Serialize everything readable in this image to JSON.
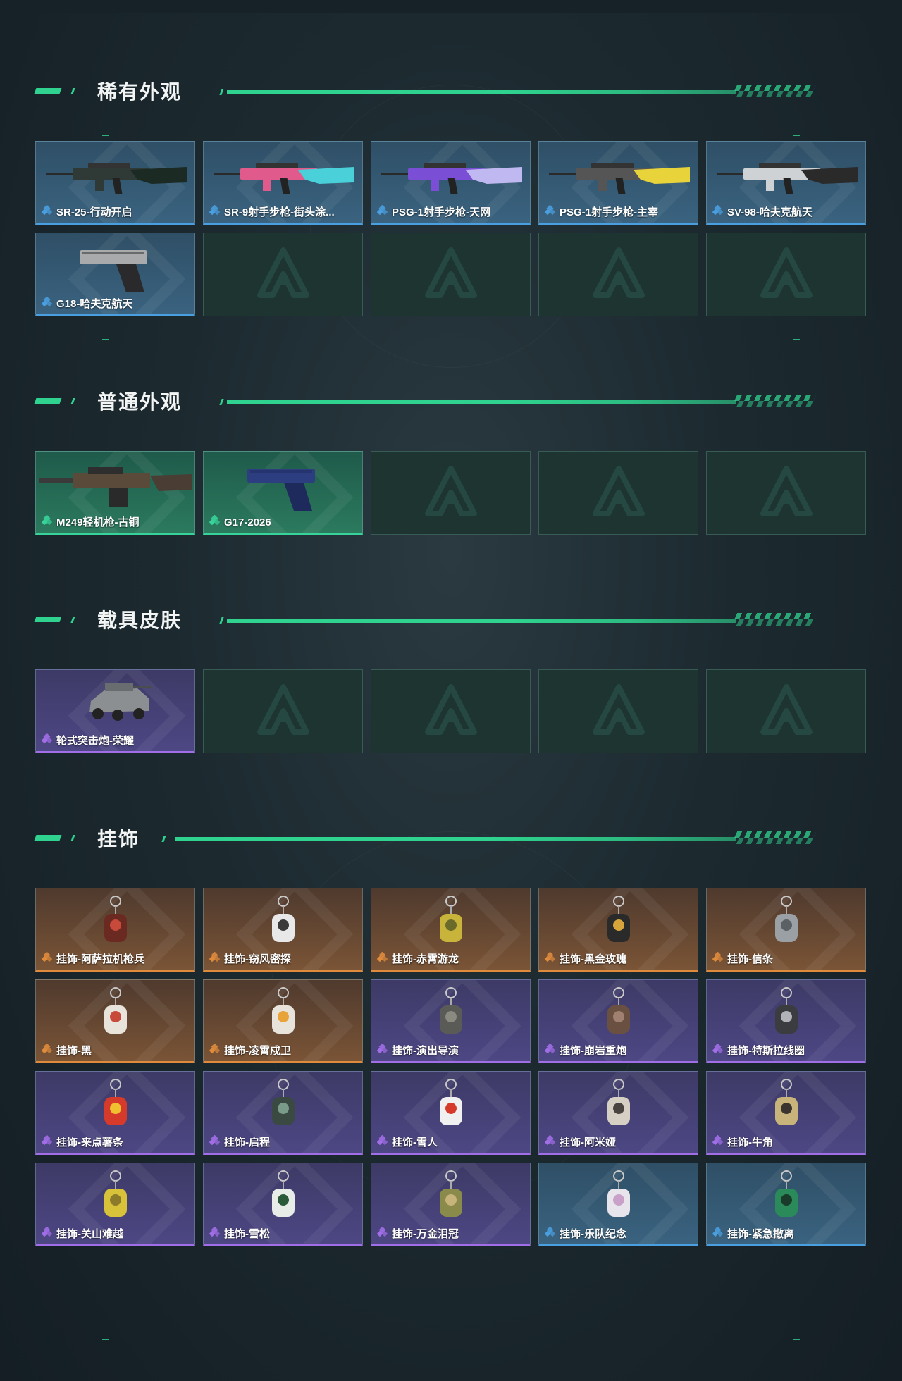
{
  "sections": [
    {
      "title": "稀有外观",
      "items": [
        {
          "label": "SR-25-行动开启",
          "rarity": "blue",
          "icon": "rifle-teal-camo"
        },
        {
          "label": "SR-9射手步枪-街头涂...",
          "rarity": "blue",
          "icon": "rifle-pink-graffiti"
        },
        {
          "label": "PSG-1射手步枪-天网",
          "rarity": "blue",
          "icon": "rifle-purple"
        },
        {
          "label": "PSG-1射手步枪-主宰",
          "rarity": "blue",
          "icon": "rifle-yellow"
        },
        {
          "label": "SV-98-哈夫克航天",
          "rarity": "blue",
          "icon": "rifle-white-black"
        },
        {
          "label": "G18-哈夫克航天",
          "rarity": "blue",
          "icon": "pistol-grey"
        }
      ]
    },
    {
      "title": "普通外观",
      "items": [
        {
          "label": "M249轻机枪-古铜",
          "rarity": "green",
          "icon": "machine-gun-bronze"
        },
        {
          "label": "G17-2026",
          "rarity": "green",
          "icon": "pistol-blue"
        }
      ]
    },
    {
      "title": "载具皮肤",
      "items": [
        {
          "label": "轮式突击炮-荣耀",
          "rarity": "purple",
          "icon": "armored-vehicle"
        }
      ]
    },
    {
      "title": "挂饰",
      "items": [
        {
          "label": "挂饰-阿萨拉机枪兵",
          "rarity": "orange",
          "icon": "charm-gunner"
        },
        {
          "label": "挂饰-窃风密探",
          "rarity": "orange",
          "icon": "charm-spy"
        },
        {
          "label": "挂饰-赤霄游龙",
          "rarity": "orange",
          "icon": "charm-dragon"
        },
        {
          "label": "挂饰-黑金玫瑰",
          "rarity": "orange",
          "icon": "charm-rose"
        },
        {
          "label": "挂饰-信条",
          "rarity": "orange",
          "icon": "charm-creed"
        },
        {
          "label": "挂饰-黑",
          "rarity": "orange",
          "icon": "charm-tag"
        },
        {
          "label": "挂饰-凌霄戍卫",
          "rarity": "orange",
          "icon": "charm-guard"
        },
        {
          "label": "挂饰-演出导演",
          "rarity": "purple",
          "icon": "charm-director"
        },
        {
          "label": "挂饰-崩岩重炮",
          "rarity": "purple",
          "icon": "charm-cannon"
        },
        {
          "label": "挂饰-特斯拉线圈",
          "rarity": "purple",
          "icon": "charm-coil"
        },
        {
          "label": "挂饰-来点薯条",
          "rarity": "purple",
          "icon": "charm-fries"
        },
        {
          "label": "挂饰-启程",
          "rarity": "purple",
          "icon": "charm-badge"
        },
        {
          "label": "挂饰-雪人",
          "rarity": "purple",
          "icon": "charm-snowman"
        },
        {
          "label": "挂饰-阿米娅",
          "rarity": "purple",
          "icon": "charm-bunny"
        },
        {
          "label": "挂饰-牛角",
          "rarity": "purple",
          "icon": "charm-horns"
        },
        {
          "label": "挂饰-关山难越",
          "rarity": "purple",
          "icon": "charm-bottle"
        },
        {
          "label": "挂饰-雪松",
          "rarity": "purple",
          "icon": "charm-tree"
        },
        {
          "label": "挂饰-万金泪冠",
          "rarity": "purple",
          "icon": "charm-crown"
        },
        {
          "label": "挂饰-乐队纪念",
          "rarity": "blue",
          "icon": "charm-disc"
        },
        {
          "label": "挂饰-紧急撤离",
          "rarity": "blue",
          "icon": "charm-cube"
        }
      ]
    }
  ],
  "colors": {
    "accent": "#2fd38f",
    "blue": "#4a9fe0",
    "green": "#37d39a",
    "purple": "#a26ee8",
    "orange": "#e08b3c"
  }
}
